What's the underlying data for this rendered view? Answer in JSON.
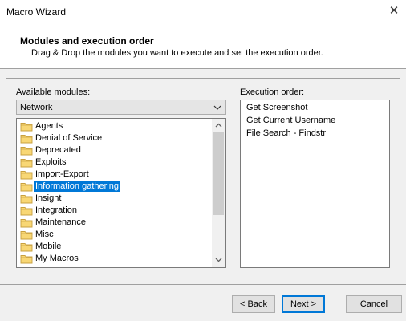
{
  "window": {
    "title": "Macro Wizard",
    "close_glyph": "✕"
  },
  "header": {
    "title": "Modules and execution order",
    "subtitle": "Drag & Drop the modules you want to execute and set the execution order."
  },
  "available": {
    "label": "Available modules:",
    "selected_category": "Network",
    "items": [
      {
        "label": "Agents",
        "selected": false
      },
      {
        "label": "Denial of Service",
        "selected": false
      },
      {
        "label": "Deprecated",
        "selected": false
      },
      {
        "label": "Exploits",
        "selected": false
      },
      {
        "label": "Import-Export",
        "selected": false
      },
      {
        "label": "Information gathering",
        "selected": true
      },
      {
        "label": "Insight",
        "selected": false
      },
      {
        "label": "Integration",
        "selected": false
      },
      {
        "label": "Maintenance",
        "selected": false
      },
      {
        "label": "Misc",
        "selected": false
      },
      {
        "label": "Mobile",
        "selected": false
      },
      {
        "label": "My Macros",
        "selected": false
      }
    ]
  },
  "execution": {
    "label": "Execution order:",
    "items": [
      "Get Screenshot",
      "Get Current Username",
      "File Search - Findstr"
    ]
  },
  "buttons": {
    "back": "< Back",
    "next": "Next >",
    "cancel": "Cancel"
  },
  "colors": {
    "selection": "#0078d7",
    "folder_fill": "#f8d775",
    "folder_stroke": "#c8a040"
  }
}
